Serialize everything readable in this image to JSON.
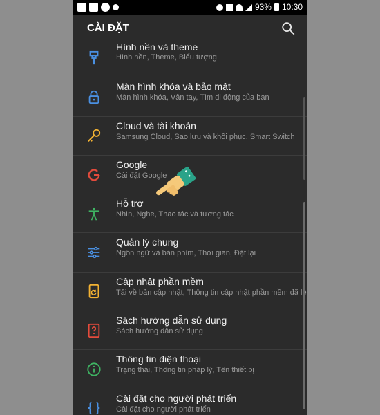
{
  "statusbar": {
    "battery": "93%",
    "time": "10:30"
  },
  "appbar": {
    "title": "CÀI ĐẶT"
  },
  "items": [
    {
      "title": "Hình nền và theme",
      "subtitle": "Hình nền, Theme, Biểu tượng",
      "icon": "paintbrush-icon",
      "color": "#4a90e2"
    },
    {
      "title": "Màn hình khóa và bảo mật",
      "subtitle": "Màn hình khóa, Vân tay, Tìm di động của bạn",
      "icon": "lock-icon",
      "color": "#4a90e2"
    },
    {
      "title": "Cloud và tài khoản",
      "subtitle": "Samsung Cloud, Sao lưu và khôi phục, Smart Switch",
      "icon": "key-icon",
      "color": "#f2b233"
    },
    {
      "title": "Google",
      "subtitle": "Cài đặt Google",
      "icon": "google-icon",
      "color": "#e44b3c"
    },
    {
      "title": "Hỗ trợ",
      "subtitle": "Nhìn, Nghe, Thao tác và tương tác",
      "icon": "accessibility-icon",
      "color": "#3fb463"
    },
    {
      "title": "Quản lý chung",
      "subtitle": "Ngôn ngữ và bàn phím, Thời gian, Đặt lại",
      "icon": "sliders-icon",
      "color": "#4a90e2"
    },
    {
      "title": "Cập nhật phần mềm",
      "subtitle": "Tải về bản cập nhật, Thông tin cập nhật phần mềm đã lên lịch",
      "icon": "software-update-icon",
      "color": "#f2b233"
    },
    {
      "title": "Sách hướng dẫn sử dụng",
      "subtitle": "Sách hướng dẫn sử dụng",
      "icon": "manual-icon",
      "color": "#e44b3c"
    },
    {
      "title": "Thông tin điện thoại",
      "subtitle": "Trạng thái, Thông tin pháp lý, Tên thiết bị",
      "icon": "info-icon",
      "color": "#3fb463"
    },
    {
      "title": "Cài đặt cho người phát triển",
      "subtitle": "Cài đặt cho người phát triển",
      "icon": "developer-icon",
      "color": "#4a90e2"
    }
  ]
}
